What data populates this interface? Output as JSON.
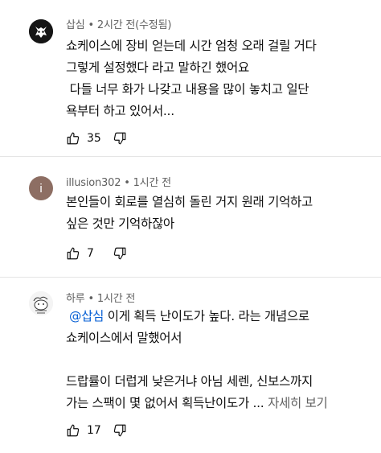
{
  "comments": [
    {
      "author": "삽심",
      "time": "2시간 전",
      "edited": "(수정됨)",
      "lines": [
        "쇼케이스에 장비 얻는데 시간 엄청 오래 걸릴 거다",
        "그렇게 설정했다 라고 말하긴 했어요",
        " 다들 너무 화가 나갖고 내용을 많이 놓치고 일단",
        "욕부터 하고 있어서..."
      ],
      "likes": "35"
    },
    {
      "author": "illusion302",
      "time": "1시간 전",
      "avatar_letter": "i",
      "lines": [
        "본인들이 회로를 열심히 돌린 거지 원래 기억하고",
        "싶은 것만 기억하잖아"
      ],
      "likes": "7"
    },
    {
      "author": "하루",
      "time": "1시간 전",
      "mention": "@삽심",
      "line1_rest": " 이게 획득 난이도가 높다. 라는 개념으로",
      "line2": "쇼케이스에서 말했어서",
      "line3": "드랍률이 더럽게 낮은거냐 아님 세렌, 신보스까지",
      "line4": "가는 스팩이 몇 없어서 획득난이도가 ...",
      "read_more": "자세히 보기",
      "likes": "17"
    }
  ],
  "separator": " • ",
  "colors": {
    "accent": "#065fd4",
    "meta": "#606060",
    "avatar_i": "#8d6e63"
  },
  "icons": [
    "thumbs-up-icon",
    "thumbs-down-icon"
  ]
}
